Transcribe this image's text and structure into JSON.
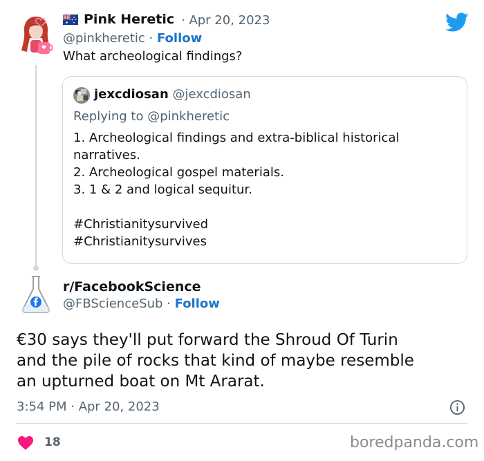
{
  "tweet1": {
    "display_name": "Pink Heretic",
    "date": "· Apr 20, 2023",
    "handle": "@pinkheretic",
    "sep": "·",
    "follow": "Follow",
    "text": "What archeological findings?"
  },
  "quoted": {
    "display_name": "jexcdiosan",
    "handle": "@jexcdiosan",
    "replying_to": "Replying to",
    "replying_handle": "@pinkheretic",
    "lines": [
      "1. Archeological findings and extra-biblical historical",
      "narratives.",
      "2. Archeological gospel materials.",
      "3. 1 & 2 and logical sequitur.",
      "#Christianitysurvived",
      "#Christianitysurvives"
    ]
  },
  "tweet2": {
    "display_name": "r/FacebookScience",
    "handle": "@FBScienceSub",
    "sep": "·",
    "follow": "Follow",
    "lines": [
      "€30 says they'll put forward the Shroud Of Turin",
      "and the pile of rocks that kind of maybe resemble",
      "an upturned boat on Mt Ararat."
    ],
    "timestamp": "3:54 PM · Apr 20, 2023",
    "likes": "18"
  },
  "watermark": "boredpanda.com",
  "icons": {
    "flag": "australia-flag-icon",
    "bird": "twitter-bird-icon",
    "info": "info-icon",
    "heart": "heart-icon"
  },
  "colors": {
    "twitter_blue": "#1d9bf0",
    "follow_blue": "#1d75c9",
    "heart_red": "#f91880",
    "muted": "#536471"
  }
}
